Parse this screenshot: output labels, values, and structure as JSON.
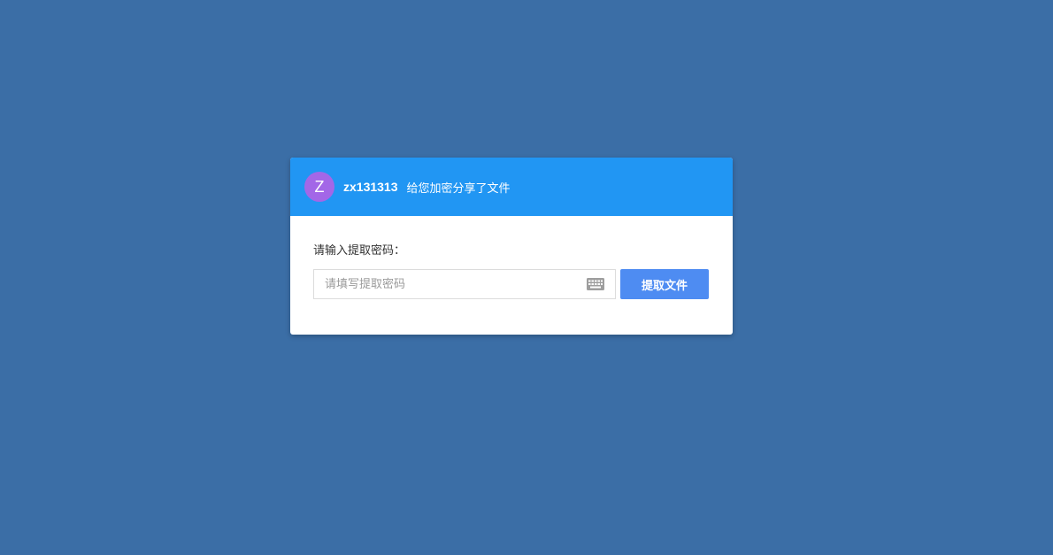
{
  "header": {
    "avatar_letter": "Z",
    "username": "zx131313",
    "share_text": "给您加密分享了文件"
  },
  "body": {
    "prompt_label": "请输入提取密码：",
    "password_input": {
      "placeholder": "请填写提取密码",
      "value": ""
    },
    "keyboard_icon": "keyboard-icon",
    "extract_button_label": "提取文件"
  },
  "colors": {
    "page_background": "#3b6ea6",
    "header_background": "#2196f3",
    "avatar_background": "#a367e7",
    "button_background": "#4e8cf2"
  }
}
